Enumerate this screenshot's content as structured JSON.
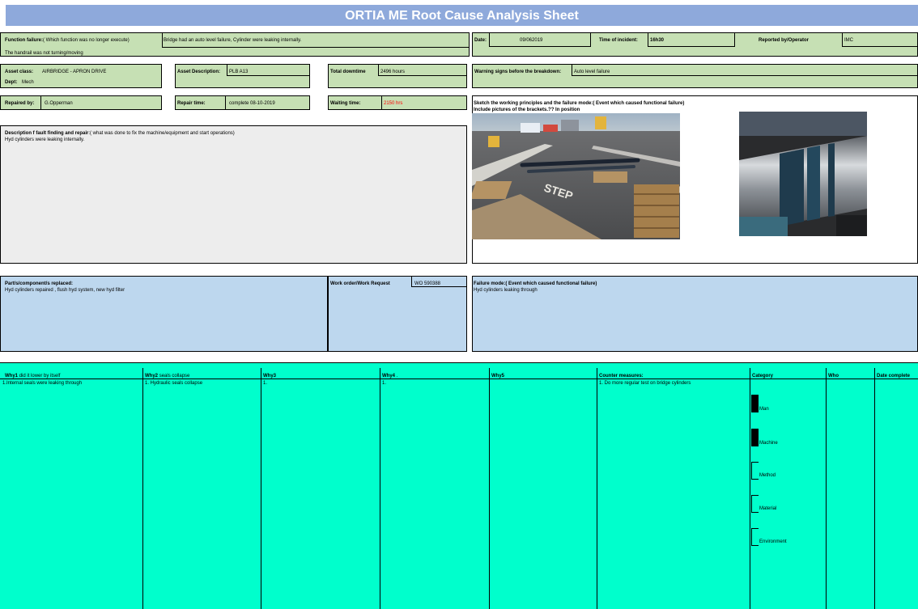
{
  "title": "ORTIA ME Root Cause Analysis Sheet",
  "row1": {
    "function_failure_label": "Function failure:",
    "function_failure_hint": "( Which function was no longer execute)",
    "function_failure_value": "Bridge had an auto level failure, Cylinder were leaking internally.",
    "function_failure_value2": "The handrail was not turning/moving",
    "date_label": "Date:",
    "date_value": "09/062019",
    "time_label": "Time of incident:",
    "time_value": "16h30",
    "reported_label": "Reported by/Operator",
    "reported_value": "IMC"
  },
  "row2": {
    "asset_class_label": "Asset class:",
    "asset_class_value": "AIRBRIDGE - APRON DRIVE",
    "dept_label": "Dept:",
    "dept_value": "Mech",
    "asset_desc_label": "Asset Description:",
    "asset_desc_value": "PLB A13",
    "total_downtime_label": "Total downtime",
    "total_downtime_value": "2496  hours",
    "warning_label": "Warning signs before the breakdown:",
    "warning_value": "Auto level failure"
  },
  "row3": {
    "repaired_label": "Repaired by:",
    "repaired_value": "G.Opperman",
    "repair_time_label": "Repair time:",
    "repair_time_value": "complete 08-10-2019",
    "waiting_label": "Waiting time:",
    "waiting_value": "2150 hrs",
    "sketch_label": "Sketch the working principles and the failure mode:( Event which caused functional failure)",
    "sketch_label2": "Include pictures of the brackets.?? In position"
  },
  "description": {
    "label": "Description f fault finding and repair",
    "hint": ":( what was done to fix the machine/equipment and start operations)",
    "value": "Hyd cylinders were leaking internally."
  },
  "parts": {
    "label": "Part/s/component/s  replaced:",
    "value": "Hyd cylinders repaired , flush hyd system, new hyd filter",
    "work_order_label": "Work order/Work Request",
    "work_order_value": "WO 590388",
    "failure_mode_label": "Failure mode:( Event which caused functional failure)",
    "failure_mode_value": "Hyd cylinders leaking through"
  },
  "whys": {
    "why1_label": "Why1",
    "why1_hint": "did it lower by itself",
    "why1_value": "1.Internal seals were leaking through",
    "why2_label": "Why2",
    "why2_hint": "seals collapse",
    "why2_value": "1. Hydraulic seals collapse",
    "why3_label": "Why3",
    "why3_value": "1.",
    "why4_label": "Why4",
    "why4_hint": ".",
    "why4_value": "1.",
    "why5_label": "Why5",
    "counter_label": "Counter measures:",
    "counter_value": "1. Do more regular test on bridge cylinders",
    "category_label": "Category",
    "who_label": "Who",
    "date_complete_label": "Date complete",
    "categories": [
      "Man",
      "Machine",
      "Method",
      "Material",
      "Environment"
    ]
  }
}
